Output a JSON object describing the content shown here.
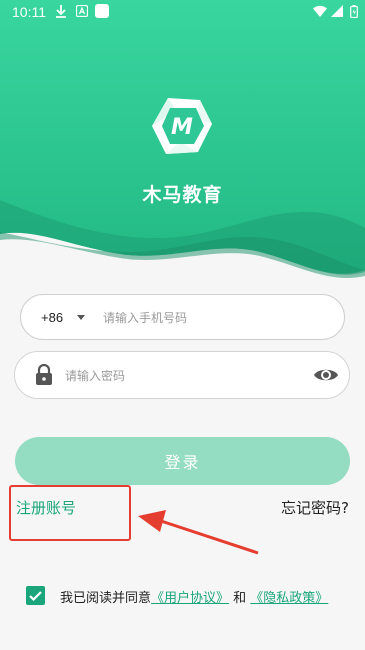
{
  "status_bar": {
    "time": "10:11",
    "icons": [
      "download-icon",
      "a-badge-icon",
      "app-icon",
      "wifi-icon",
      "signal-icon",
      "battery-icon"
    ]
  },
  "app": {
    "name": "木马教育",
    "logo_letter": "M"
  },
  "phone_field": {
    "country_code": "+86",
    "placeholder": "请输入手机号码",
    "value": ""
  },
  "password_field": {
    "placeholder": "请输入密码",
    "value": ""
  },
  "login_button": {
    "label": "登录"
  },
  "links": {
    "register": "注册账号",
    "forgot_password": "忘记密码?"
  },
  "agreement": {
    "checked": true,
    "prefix": "我已阅读并同意",
    "user_agreement": "《用户协议》",
    "and": " 和 ",
    "privacy_policy": "《隐私政策》"
  },
  "colors": {
    "brand_green": "#1aa67a",
    "header_green": "#2ec795",
    "button_disabled": "#94dcc2",
    "annotation_red": "#e53d2f"
  }
}
